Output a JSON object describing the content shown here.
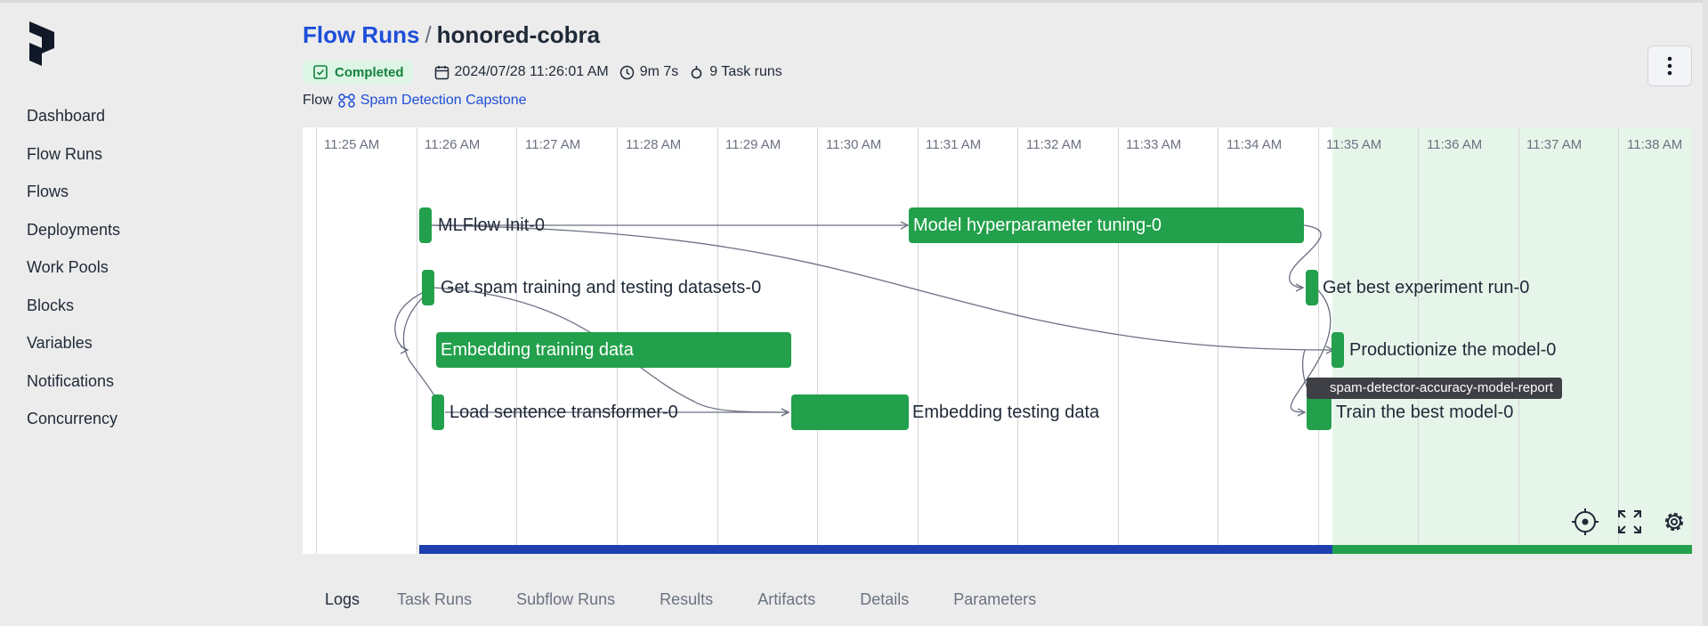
{
  "brand": {
    "logo_icon": "prefect-logo-icon"
  },
  "sidebar": {
    "items": [
      {
        "label": "Dashboard"
      },
      {
        "label": "Flow Runs"
      },
      {
        "label": "Flows"
      },
      {
        "label": "Deployments"
      },
      {
        "label": "Work Pools"
      },
      {
        "label": "Blocks"
      },
      {
        "label": "Variables"
      },
      {
        "label": "Notifications"
      },
      {
        "label": "Concurrency"
      }
    ]
  },
  "header": {
    "breadcrumb_link": "Flow Runs",
    "separator": "/",
    "run_name": "honored-cobra",
    "status": "Completed",
    "start_time": "2024/07/28 11:26:01 AM",
    "duration": "9m 7s",
    "task_runs": "9 Task runs",
    "flow_prefix": "Flow",
    "flow_name": "Spam Detection Capstone",
    "menu_icon": "kebab-menu-icon"
  },
  "timeline": {
    "ticks": [
      "11:25 AM",
      "11:26 AM",
      "11:27 AM",
      "11:28 AM",
      "11:29 AM",
      "11:30 AM",
      "11:31 AM",
      "11:32 AM",
      "11:33 AM",
      "11:34 AM",
      "11:35 AM",
      "11:36 AM",
      "11:37 AM",
      "11:38 AM"
    ],
    "nodes": [
      {
        "label": "MLFlow Init-0"
      },
      {
        "label": "Model hyperparameter tuning-0"
      },
      {
        "label": "Get spam training and testing datasets-0"
      },
      {
        "label": "Get best experiment run-0"
      },
      {
        "label": "Embedding training data"
      },
      {
        "label": "Productionize the model-0"
      },
      {
        "label": "Load sentence transformer-0"
      },
      {
        "label": "Embedding testing data"
      },
      {
        "label": "Train the best model-0"
      }
    ],
    "artifact_label": "spam-detector-accuracy-model-report",
    "controls": [
      "recenter-icon",
      "fullscreen-icon",
      "settings-icon"
    ],
    "colors": {
      "task_completed": "#22a04b",
      "progress_past": "#1e40af",
      "now_zone": "#e6f5ea"
    }
  },
  "tabs": [
    "Logs",
    "Task Runs",
    "Subflow Runs",
    "Results",
    "Artifacts",
    "Details",
    "Parameters"
  ]
}
